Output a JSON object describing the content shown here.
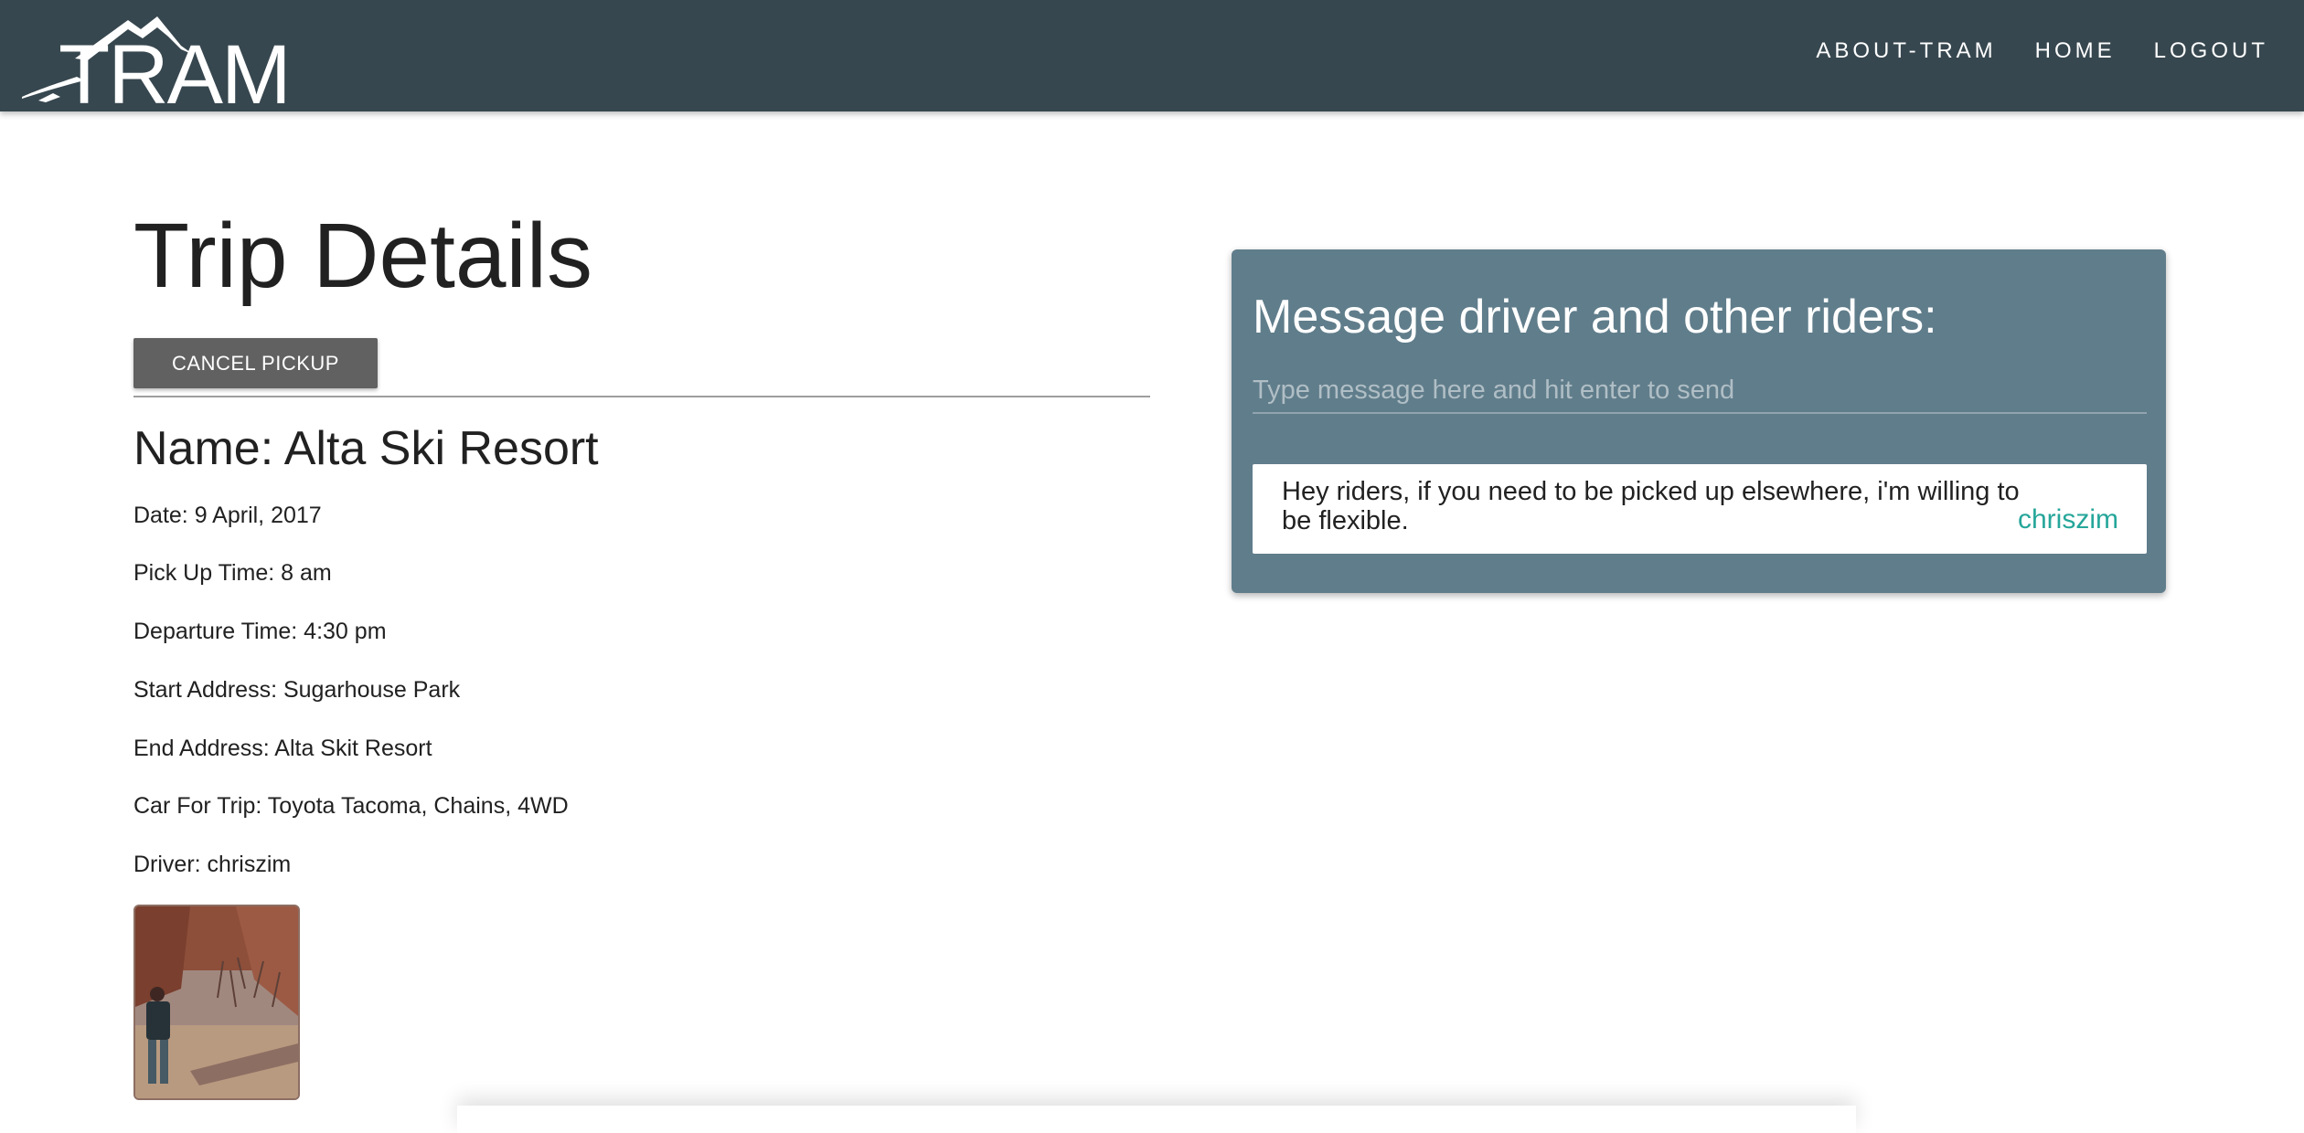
{
  "nav": {
    "brand": "TRAM",
    "links": [
      "ABOUT-TRAM",
      "HOME",
      "LOGOUT"
    ]
  },
  "trip": {
    "page_title": "Trip Details",
    "cancel_label": "CANCEL PICKUP",
    "name": "Name: Alta Ski Resort",
    "date": "Date: 9 April, 2017",
    "pickup_time": "Pick Up Time: 8 am",
    "departure_time": "Departure Time: 4:30 pm",
    "start_address": "Start Address: Sugarhouse Park",
    "end_address": "End Address: Alta Skit Resort",
    "car": "Car For Trip: Toyota Tacoma, Chains, 4WD",
    "driver": "Driver: chriszim"
  },
  "messages": {
    "title": "Message driver and other riders:",
    "input_placeholder": "Type message here and hit enter to send",
    "items": [
      {
        "text": "Hey riders, if you need to be picked up elsewhere, i'm willing to be flexible.",
        "author": "chriszim"
      }
    ]
  },
  "colors": {
    "navbar": "#37474f",
    "card": "#607d8b",
    "button": "#616161",
    "author": "#26a69a"
  },
  "icons": {
    "logo": "mountain-logo-icon"
  }
}
